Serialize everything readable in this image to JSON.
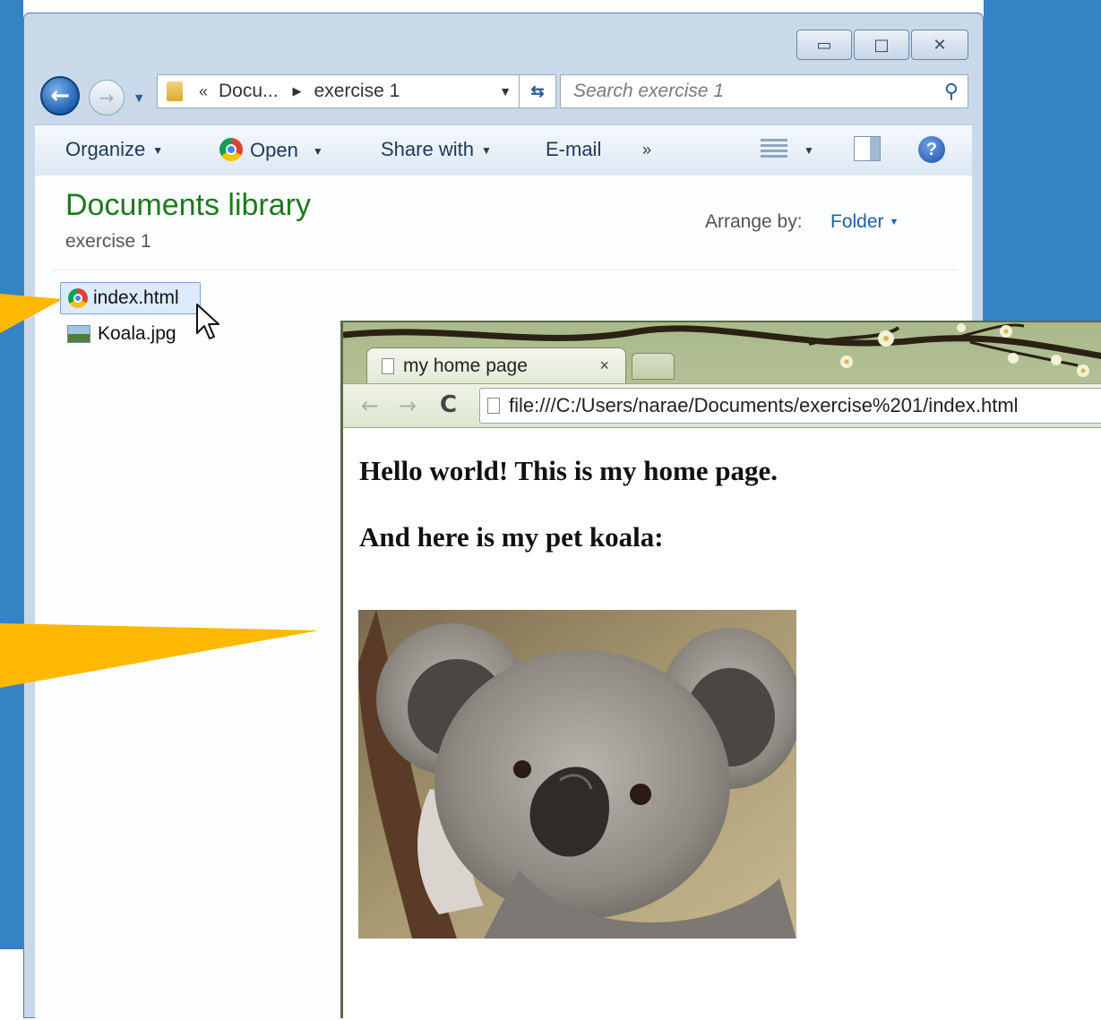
{
  "explorer": {
    "window_controls": {
      "minimize": "▭",
      "maximize": "□",
      "close": "✕"
    },
    "address": {
      "chevrons": "«",
      "segment1": "Docu...",
      "segment2": "exercise 1"
    },
    "search": {
      "placeholder": "Search exercise 1"
    },
    "toolbar": {
      "organize": "Organize",
      "open": "Open",
      "share_with": "Share with",
      "email": "E-mail",
      "more": "»"
    },
    "library": {
      "title": "Documents library",
      "subtitle": "exercise 1"
    },
    "arrange": {
      "label": "Arrange by:",
      "value": "Folder"
    },
    "files": [
      {
        "name": "index.html",
        "icon": "chrome-icon",
        "selected": true
      },
      {
        "name": "Koala.jpg",
        "icon": "image-icon",
        "selected": false
      }
    ]
  },
  "browser": {
    "tab_title": "my home page",
    "tab_close": "×",
    "url": "file:///C:/Users/narae/Documents/exercise%201/index.html",
    "page": {
      "heading1": "Hello world! This is my home page.",
      "heading2": "And here is my pet koala:"
    }
  },
  "colors": {
    "desktop": "#3582c4",
    "explorer_frame": "#c9d9ea",
    "library_title": "#1e7a1e",
    "annotation_arrow": "#ffb800",
    "browser_theme": "#a9b98b"
  }
}
